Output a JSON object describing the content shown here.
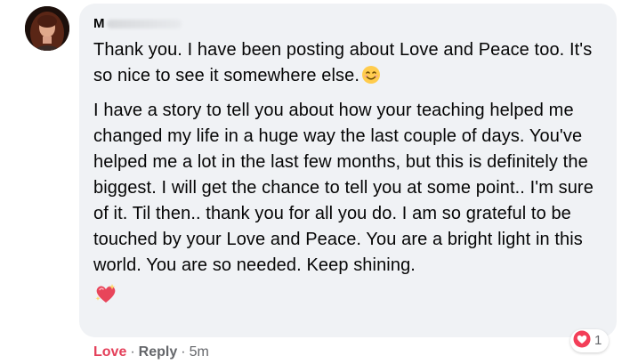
{
  "comment": {
    "author": "M",
    "paragraphs": [
      "Thank you. I have been posting about Love and Peace too. It's so nice to see it somewhere else.",
      "I have a story to tell you about how your teaching helped me changed my life in a huge way the last couple of days. You've helped me a lot in the last few months, but this is definitely the biggest. I will get the chance to tell you at some point.. I'm sure of it. Til then.. thank you for all you do. I am so grateful to be touched by your Love and Peace. You are a bright light in this world. You are so needed. Keep shining."
    ],
    "emoji_after_first": "smiling-face-icon",
    "trailing_emoji": "sparkling-heart-icon"
  },
  "actions": {
    "love_label": "Love",
    "separator": "·",
    "reply_label": "Reply",
    "timestamp": "5m"
  },
  "reactions": {
    "icon": "heart-reaction-icon",
    "count": "1"
  },
  "colors": {
    "bubble": "#f0f2f5",
    "love": "#e4405a",
    "meta": "#65676b",
    "text": "#050505"
  }
}
